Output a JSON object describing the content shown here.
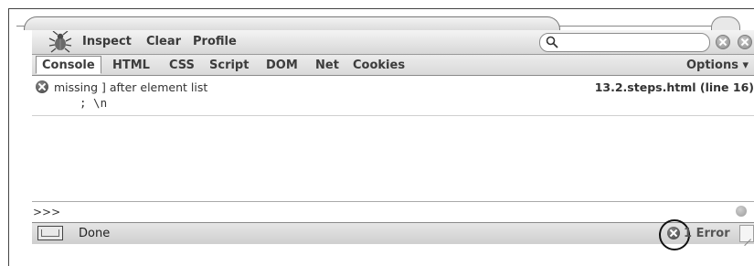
{
  "toolbar": {
    "inspect_label": "Inspect",
    "clear_label": "Clear",
    "profile_label": "Profile",
    "search_placeholder": ""
  },
  "tabs": [
    {
      "label": "Console"
    },
    {
      "label": "HTML"
    },
    {
      "label": "CSS"
    },
    {
      "label": "Script"
    },
    {
      "label": "DOM"
    },
    {
      "label": "Net"
    },
    {
      "label": "Cookies"
    }
  ],
  "options_label": "Options ▾",
  "console": {
    "entries": [
      {
        "message": "missing ] after element list",
        "source": "13.2.steps.html (line 16)",
        "code": "; \\n"
      }
    ],
    "prompt": ">>>"
  },
  "statusbar": {
    "status": "Done",
    "error_count": "1 Error"
  },
  "colors": {
    "toolbar_bg": "#d7d7d7",
    "accent": "#3c3c3c",
    "error_icon": "#4a4a4a"
  }
}
